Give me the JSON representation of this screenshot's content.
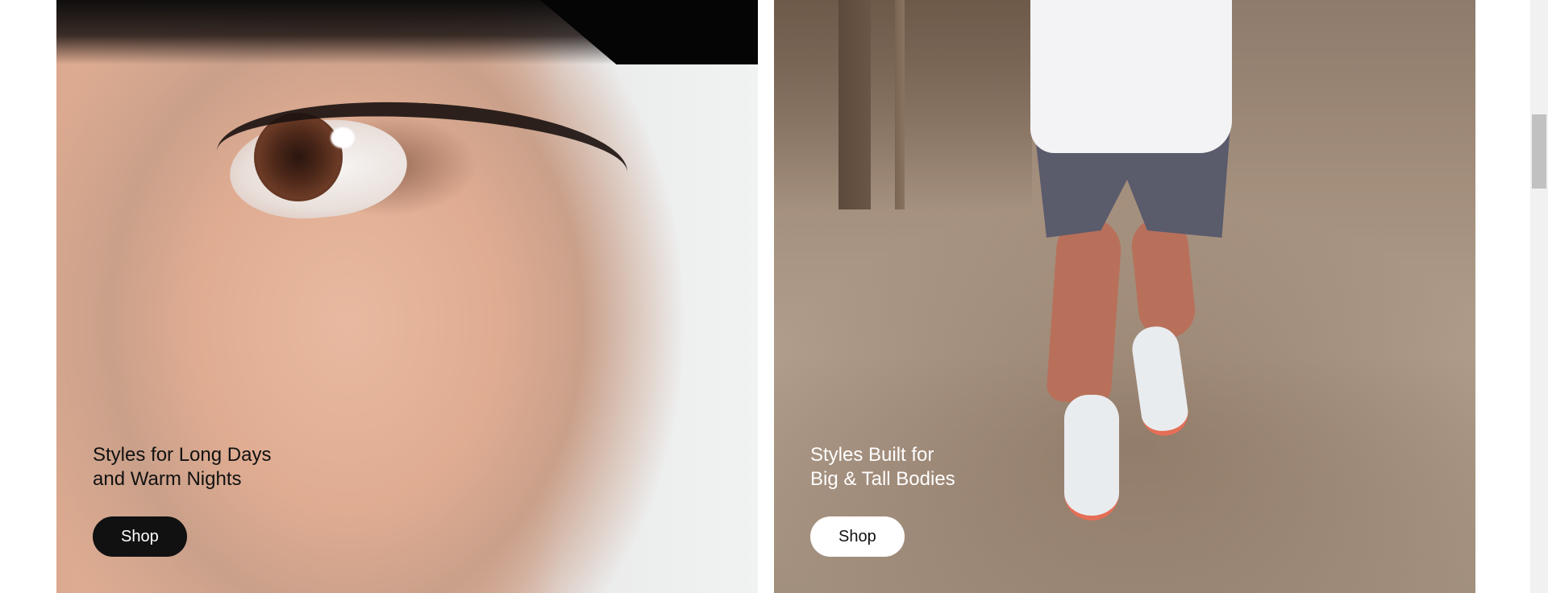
{
  "promos": [
    {
      "caption_lines": [
        "Styles for Long Days",
        "and Warm Nights"
      ],
      "button_label": "Shop"
    },
    {
      "caption_lines": [
        "Styles Built for",
        "Big & Tall Bodies"
      ],
      "button_label": "Shop"
    }
  ]
}
